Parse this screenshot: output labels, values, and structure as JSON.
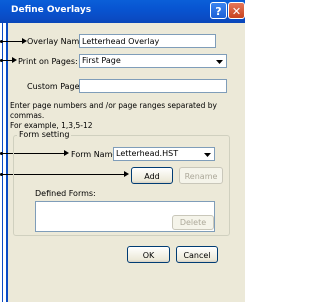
{
  "window": {
    "title": "Define Overlays",
    "help_glyph": "?",
    "close_glyph": "✕"
  },
  "overlay_name": {
    "label": "Overlay Name:",
    "value": "Letterhead Overlay"
  },
  "print_on_pages": {
    "label": "Print on Pages:",
    "selected": "First Page"
  },
  "custom_pages": {
    "label": "Custom Pages:",
    "value": ""
  },
  "hint_text": {
    "line1": "Enter page numbers and /or page ranges separated by commas.",
    "line2": "For example, 1,3,5-12"
  },
  "form_setting": {
    "legend": "Form setting",
    "form_name_label": "Form Name:",
    "form_name_selected": "Letterhead.HST",
    "add_label": "Add",
    "rename_label": "Rename",
    "defined_forms_label": "Defined Forms:",
    "defined_forms": [],
    "delete_label": "Delete"
  },
  "footer": {
    "ok_label": "OK",
    "cancel_label": "Cancel"
  },
  "colors": {
    "titlebar": "#0a54d1",
    "dialog_bg": "#ece9d8",
    "field_border": "#7f9db9"
  }
}
